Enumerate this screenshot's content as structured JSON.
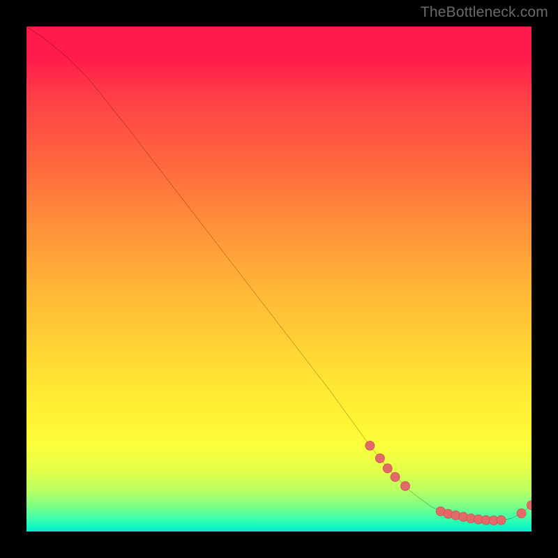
{
  "watermark": "TheBottleneck.com",
  "chart_data": {
    "type": "line",
    "title": "",
    "xlabel": "",
    "ylabel": "",
    "xlim": [
      0,
      100
    ],
    "ylim": [
      0,
      100
    ],
    "series": [
      {
        "name": "curve",
        "x": [
          0,
          3,
          8,
          12,
          20,
          30,
          40,
          50,
          60,
          68,
          72,
          76,
          80,
          82,
          85,
          88,
          90,
          92,
          94,
          96,
          98,
          100
        ],
        "y": [
          100,
          98,
          94,
          90,
          80,
          67,
          54,
          41,
          28,
          17,
          12,
          8,
          5,
          4,
          3.2,
          2.6,
          2.3,
          2.2,
          2.2,
          2.6,
          3.6,
          5.2
        ]
      }
    ],
    "markers": [
      {
        "x": 68,
        "y": 17
      },
      {
        "x": 70,
        "y": 14.5
      },
      {
        "x": 71.5,
        "y": 12.5
      },
      {
        "x": 73,
        "y": 10.8
      },
      {
        "x": 75,
        "y": 9
      },
      {
        "x": 82,
        "y": 4
      },
      {
        "x": 83.5,
        "y": 3.5
      },
      {
        "x": 85,
        "y": 3.2
      },
      {
        "x": 86.5,
        "y": 2.9
      },
      {
        "x": 88,
        "y": 2.6
      },
      {
        "x": 89.5,
        "y": 2.4
      },
      {
        "x": 91,
        "y": 2.25
      },
      {
        "x": 92.5,
        "y": 2.2
      },
      {
        "x": 94,
        "y": 2.25
      },
      {
        "x": 98,
        "y": 3.6
      },
      {
        "x": 100,
        "y": 5.2
      }
    ],
    "colors": {
      "line": "#000000",
      "marker_fill": "#e46a6a",
      "marker_stroke": "#c95555"
    }
  }
}
